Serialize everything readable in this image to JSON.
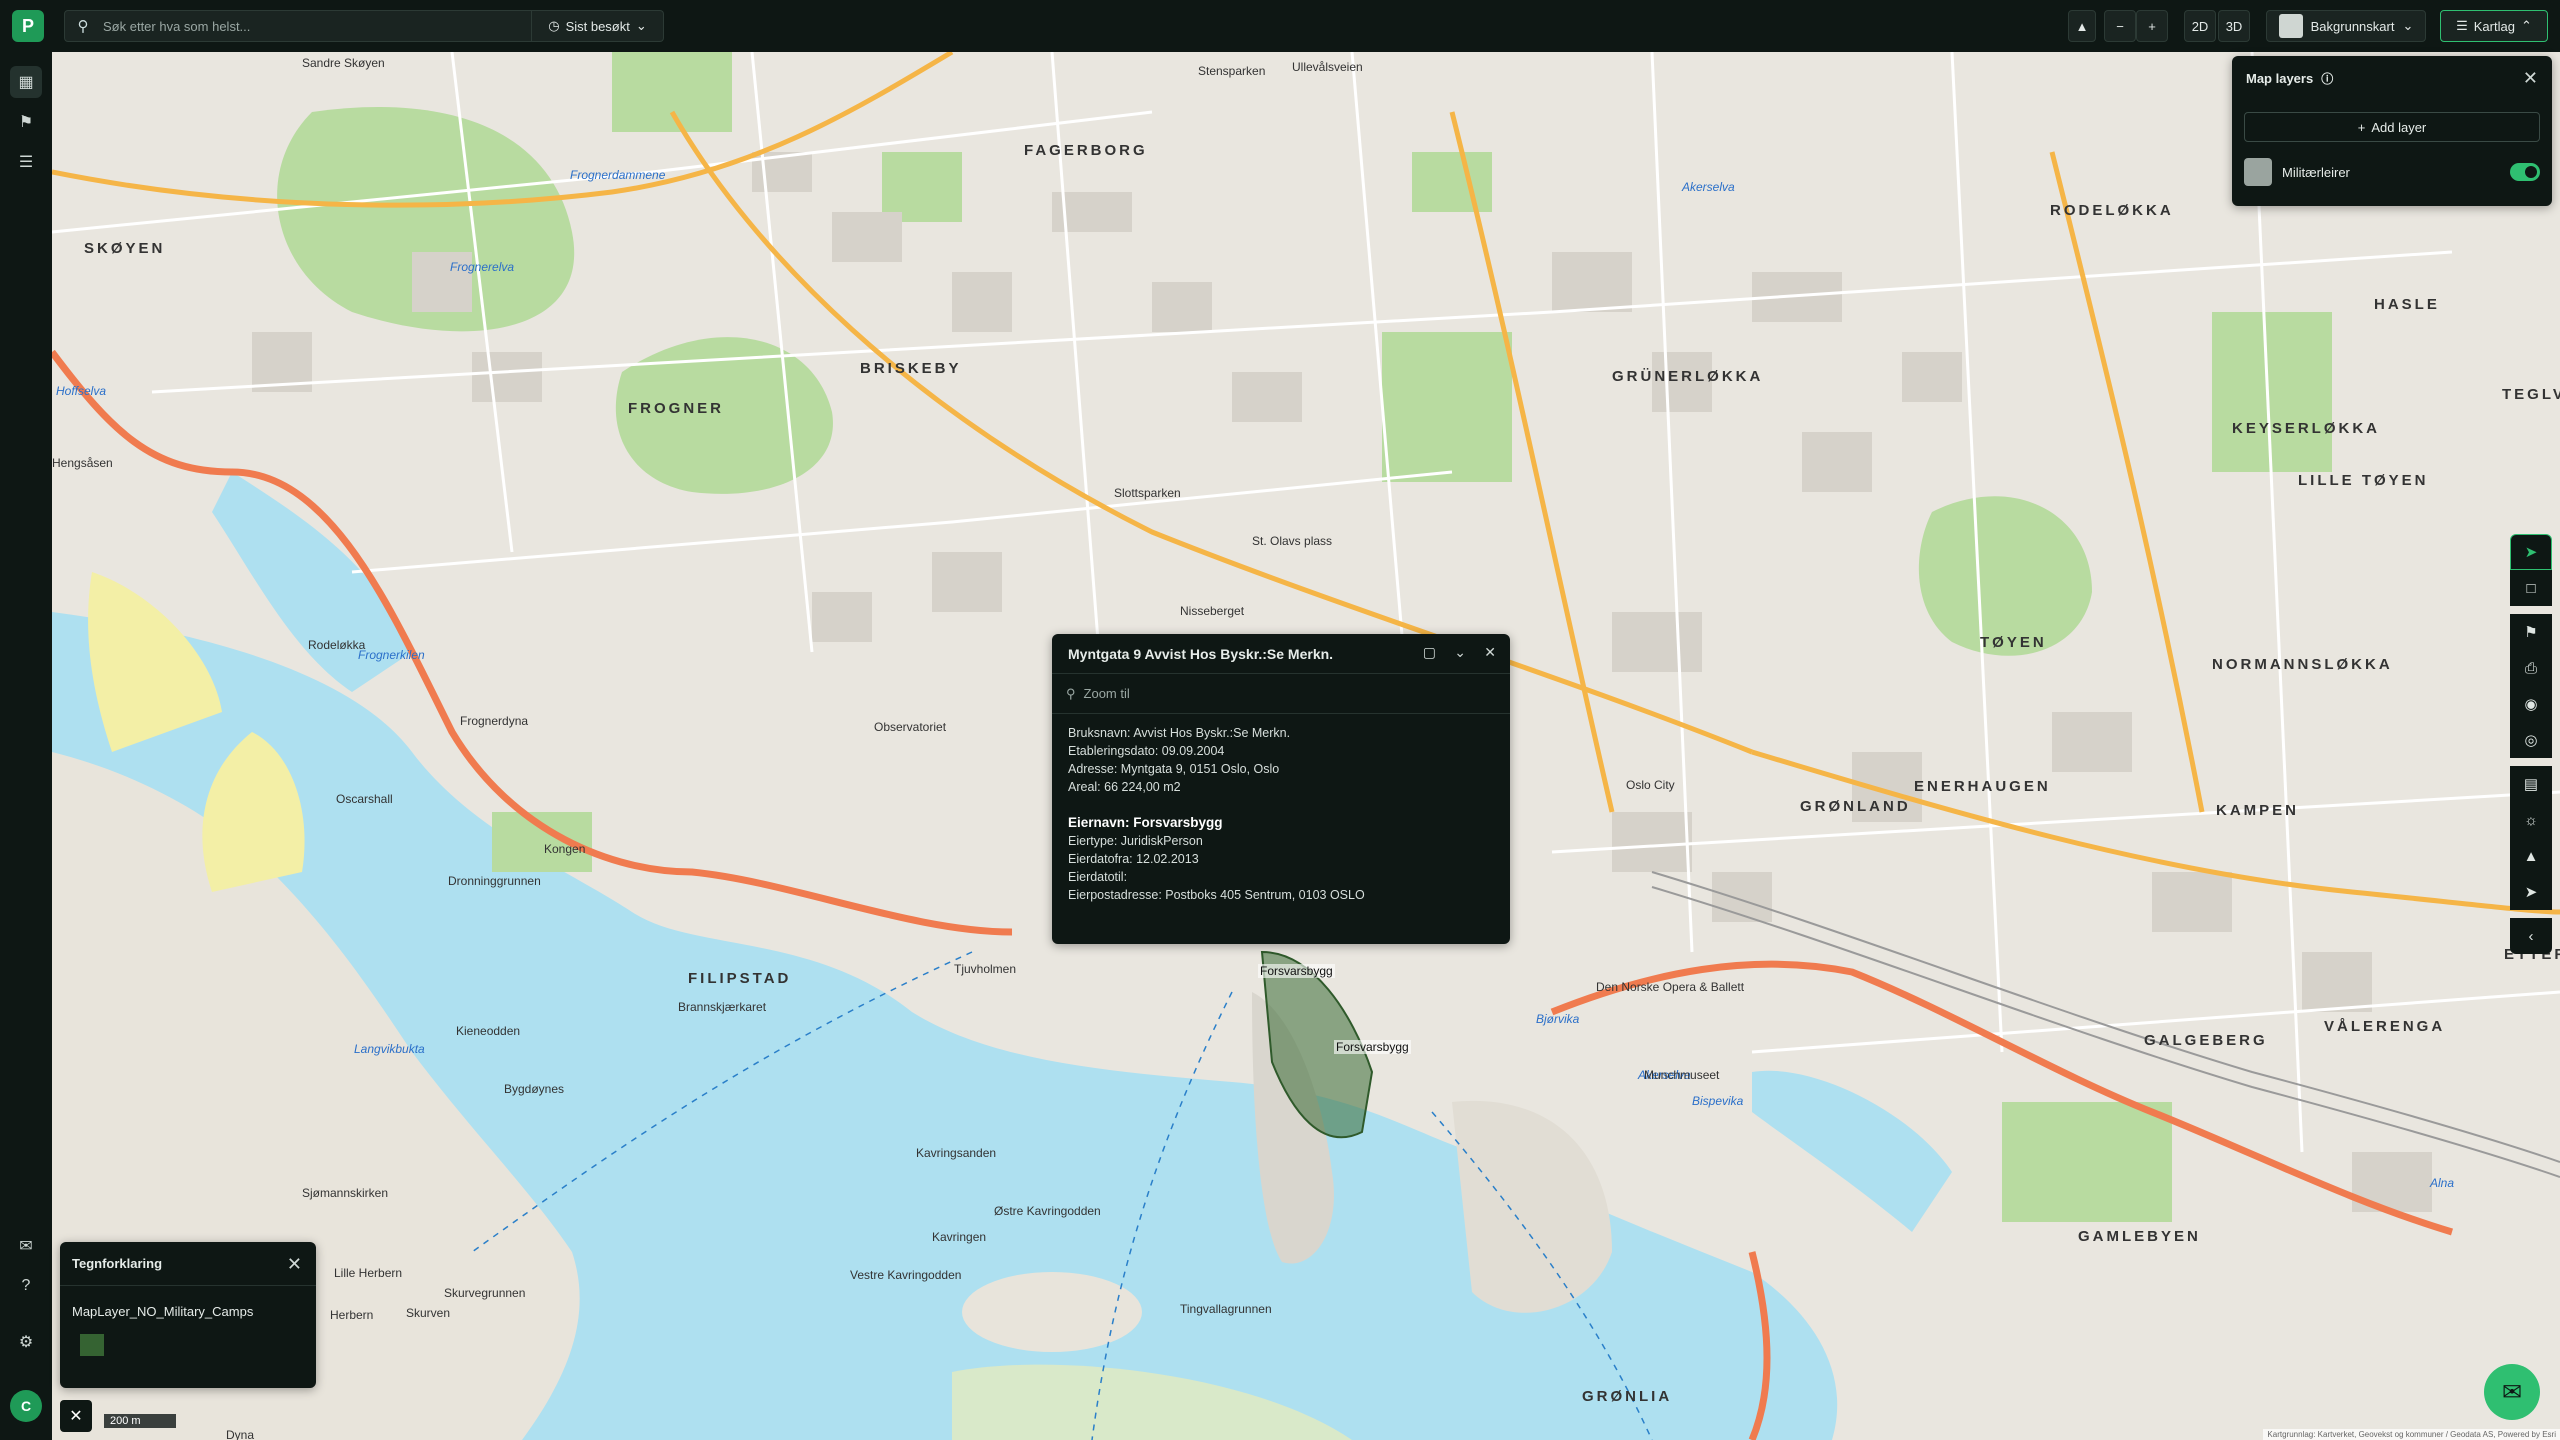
{
  "app": {
    "logo": "P"
  },
  "search": {
    "placeholder": "Søk etter hva som helst...",
    "recent_label": "Sist besøkt"
  },
  "toolbar": {
    "btn_2d": "2D",
    "btn_3d": "3D",
    "zoom_out": "−",
    "zoom_in": "+",
    "basemap_label": "Bakgrunnskart",
    "mapgroup_label": "Kartlag"
  },
  "layers_panel": {
    "title": "Map layers",
    "add_label": "Add layer",
    "layer_name": "Militærleirer",
    "layer_enabled": true
  },
  "popup": {
    "title": "Myntgata 9 Avvist Hos Byskr.:Se Merkn.",
    "zoom_placeholder": "Zoom til",
    "line1": "Bruksnavn: Avvist Hos Byskr.:Se Merkn.",
    "line2": "Etableringsdato: 09.09.2004",
    "line3": "Adresse: Myntgata 9, 0151 Oslo, Oslo",
    "line4": "Areal: 66 224,00 m2",
    "owner_heading": "Eiernavn: Forsvarsbygg",
    "line5": "Eiertype: JuridiskPerson",
    "line6": "Eierdatofra: 12.02.2013",
    "line7": "Eierdatotil:",
    "line8": "Eierpostadresse:  Postboks 405 Sentrum, 0103 OSLO"
  },
  "legend": {
    "title": "Tegnforklaring",
    "item": "MapLayer_NO_Military_Camps",
    "swatch_color": "#3a6b35"
  },
  "scale": {
    "label": "200 m"
  },
  "avatar": {
    "initial": "C"
  },
  "attribution": "Kartgrunnlag: Kartverket, Geovekst og kommuner / Geodata AS, Powered by Esri",
  "map_labels": {
    "fagerborg": "FAGERBORG",
    "rodelokka": "RODELØKKA",
    "hasle": "HASLE",
    "briskeby": "BRISKEBY",
    "skoyen": "SKØYEN",
    "frogner": "FROGNER",
    "grunerlokka": "GRÜNERLØKKA",
    "keyserlokka": "KEYSERLØKKA",
    "tegleverket": "TEGLVE",
    "lille_toyen": "LILLE TØYEN",
    "toyen": "TØYEN",
    "normannslokka": "NORMANNSLØKKA",
    "gronland": "GRØNLAND",
    "enerhaugen": "ENERHAUGEN",
    "kampen": "KAMPEN",
    "filipstad": "FILIPSTAD",
    "galgeberg": "GALGEBERG",
    "valerenga": "VÅLERENGA",
    "gamlebyen": "GAMLEBYEN",
    "gronlia": "GRØNLIA",
    "etter": "ETTER",
    "akerselva1": "Akerselva",
    "akerselva2": "Akerselva",
    "frognerelva": "Frognerelva",
    "frognerdammene": "Frognerdammene",
    "frognerkilen": "Frognerkilen",
    "hoffselva": "Hoffselva",
    "langvikbukta": "Langvikbukta",
    "bjorvika": "Bjørvika",
    "bispevika": "Bispevika",
    "alna": "Alna",
    "hengsasen": "Hengsåsen",
    "forsvarsbygg1": "Forsvarsbygg",
    "forsvarsbygg2": "Forsvarsbygg",
    "kavringen": "Kavringen",
    "kavringsanden": "Kavringsanden",
    "ostre_kavringodden": "Østre Kavringodden",
    "vestre_kavringodden": "Vestre Kavringodden",
    "tingvallagrunnen": "Tingvallagrunnen",
    "kongen": "Kongen",
    "dronningrunnen": "Dronninggrunnen",
    "oscarshall": "Oscarshall",
    "rodelokka_small": "Rodeløkka",
    "frognerdyna": "Frognerdyna",
    "bygdoynes": "Bygdøynes",
    "kieneodden": "Kieneodden",
    "sjomannskirken": "Sjømannskirken",
    "lille_herbern": "Lille Herbern",
    "herbern": "Herbern",
    "skurven": "Skurven",
    "skurvegrunnen": "Skurvegrunnen",
    "observatoriet": "Observatoriet",
    "tjuvholmen": "Tjuvholmen",
    "brannskjaerkaret": "Brannskjærkaret",
    "stenparken": "Stensparken",
    "ullevalsveien": "Ullevålsveien",
    "majorstuen": "Sandre Skøyen",
    "slottsparken": "Slottsparken",
    "nisseberget": "Nisseberget",
    "st_olavs_plass": "St. Olavs plass",
    "munchmuseet": "Munchmuseet",
    "den_norske_opera": "Den Norske Opera & Ballett",
    "jernbanetorget": "Oslo City",
    "dyna": "Dyna"
  }
}
